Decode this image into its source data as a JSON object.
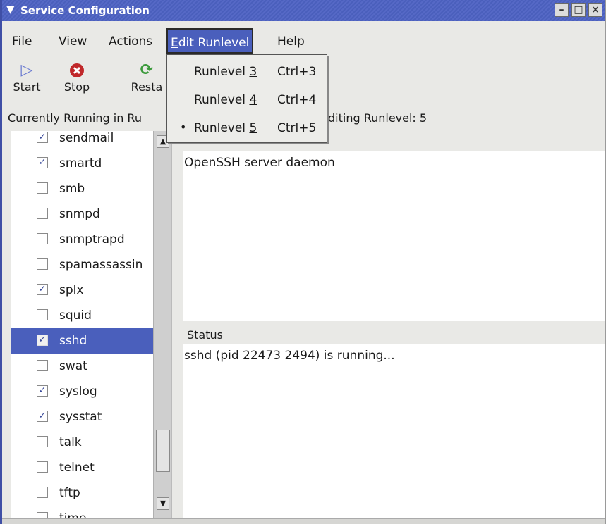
{
  "window": {
    "title": "Service Configuration"
  },
  "menubar": [
    {
      "label": "File",
      "key": "F",
      "rest": "ile"
    },
    {
      "label": "View",
      "key": "V",
      "rest": "iew"
    },
    {
      "label": "Actions",
      "key": "A",
      "rest": "ctions"
    },
    {
      "label": "Edit Runlevel",
      "key": "E",
      "rest": "dit Runlevel"
    },
    {
      "label": "Help",
      "key": "H",
      "rest": "elp"
    }
  ],
  "toolbar": {
    "start": "Start",
    "stop": "Stop",
    "restart": "Resta"
  },
  "status": {
    "running": "Currently Running in Ru",
    "editing": "diting Runlevel: 5"
  },
  "dropdown": [
    {
      "pre": "Runlevel ",
      "num": "3",
      "accel": "Ctrl+3",
      "selected": false
    },
    {
      "pre": "Runlevel ",
      "num": "4",
      "accel": "Ctrl+4",
      "selected": false
    },
    {
      "pre": "Runlevel ",
      "num": "5",
      "accel": "Ctrl+5",
      "selected": true
    }
  ],
  "services": [
    {
      "name": "sendmail",
      "checked": true
    },
    {
      "name": "smartd",
      "checked": true
    },
    {
      "name": "smb",
      "checked": false
    },
    {
      "name": "snmpd",
      "checked": false
    },
    {
      "name": "snmptrapd",
      "checked": false
    },
    {
      "name": "spamassassin",
      "checked": false
    },
    {
      "name": "splx",
      "checked": true
    },
    {
      "name": "squid",
      "checked": false
    },
    {
      "name": "sshd",
      "checked": true,
      "selected": true
    },
    {
      "name": "swat",
      "checked": false
    },
    {
      "name": "syslog",
      "checked": true
    },
    {
      "name": "sysstat",
      "checked": true
    },
    {
      "name": "talk",
      "checked": false
    },
    {
      "name": "telnet",
      "checked": false
    },
    {
      "name": "tftp",
      "checked": false
    },
    {
      "name": "time",
      "checked": false
    }
  ],
  "description": {
    "text": "OpenSSH server daemon"
  },
  "status_panel": {
    "label": "Status",
    "text": "sshd (pid 22473 2494) is running..."
  }
}
